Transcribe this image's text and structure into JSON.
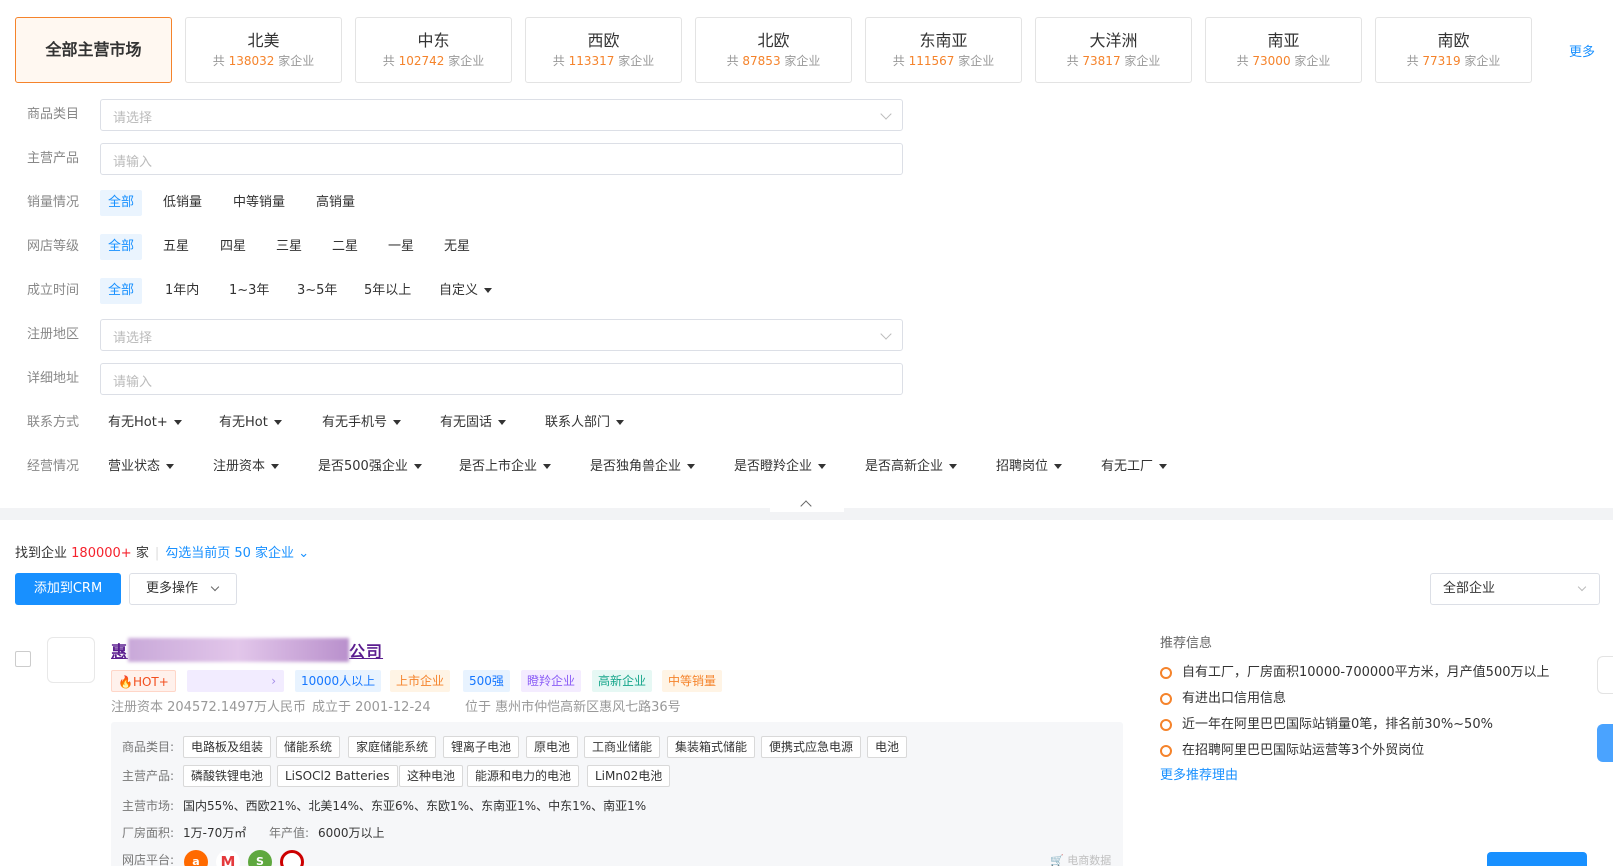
{
  "markets": [
    {
      "name": "全部主营市场",
      "active": true
    },
    {
      "name": "北美",
      "prefix": "共",
      "count": "138032",
      "suffix": "家企业"
    },
    {
      "name": "中东",
      "prefix": "共",
      "count": "102742",
      "suffix": "家企业"
    },
    {
      "name": "西欧",
      "prefix": "共",
      "count": "113317",
      "suffix": "家企业"
    },
    {
      "name": "北欧",
      "prefix": "共",
      "count": "87853",
      "suffix": "家企业"
    },
    {
      "name": "东南亚",
      "prefix": "共",
      "count": "111567",
      "suffix": "家企业"
    },
    {
      "name": "大洋洲",
      "prefix": "共",
      "count": "73817",
      "suffix": "家企业"
    },
    {
      "name": "南亚",
      "prefix": "共",
      "count": "73000",
      "suffix": "家企业"
    },
    {
      "name": "南欧",
      "prefix": "共",
      "count": "77319",
      "suffix": "家企业"
    }
  ],
  "more_label": "更多",
  "filters": {
    "category": {
      "label": "商品类目",
      "placeholder": "请选择"
    },
    "product": {
      "label": "主营产品",
      "placeholder": "请输入"
    },
    "sales": {
      "label": "销量情况",
      "options": [
        "全部",
        "低销量",
        "中等销量",
        "高销量"
      ]
    },
    "shop_level": {
      "label": "网店等级",
      "options": [
        "全部",
        "五星",
        "四星",
        "三星",
        "二星",
        "一星",
        "无星"
      ]
    },
    "founded": {
      "label": "成立时间",
      "options": [
        "全部",
        "1年内",
        "1~3年",
        "3~5年",
        "5年以上"
      ],
      "custom": "自定义"
    },
    "region": {
      "label": "注册地区",
      "placeholder": "请选择"
    },
    "address": {
      "label": "详细地址",
      "placeholder": "请输入"
    },
    "contact": {
      "label": "联系方式",
      "options": [
        "有无Hot+",
        "有无Hot",
        "有无手机号",
        "有无固话",
        "联系人部门"
      ]
    },
    "business": {
      "label": "经营情况",
      "options": [
        "营业状态",
        "注册资本",
        "是否500强企业",
        "是否上市企业",
        "是否独角兽企业",
        "是否瞪羚企业",
        "是否高新企业",
        "招聘岗位",
        "有无工厂"
      ]
    }
  },
  "results": {
    "found_prefix": "找到企业",
    "found_count": "180000+",
    "found_suffix": "家",
    "select_page": "勾选当前页 50 家企业",
    "add_crm": "添加到CRM",
    "more_actions": "更多操作",
    "scope": "全部企业"
  },
  "company": {
    "name_start": "惠",
    "name_end": "公司",
    "tags": {
      "hot": "HOT+",
      "purple": "",
      "staff": "10000人以上",
      "listed": "上市企业",
      "top500": "500强",
      "gazelle": "瞪羚企业",
      "hitech": "高新企业",
      "sales": "中等销量"
    },
    "capital": "注册资本 204572.1497万人民币",
    "founded": "成立于 2001-12-24",
    "location": "位于 惠州市仲恺高新区惠风七路36号",
    "category_label": "商品类目:",
    "categories": [
      "电路板及组装",
      "储能系统",
      "家庭储能系统",
      "锂离子电池",
      "原电池",
      "工商业储能",
      "集装箱式储能",
      "便携式应急电源",
      "电池"
    ],
    "product_label": "主营产品:",
    "products": [
      "磷酸铁锂电池",
      "LiSOCl2 Batteries",
      "这种电池",
      "能源和电力的电池",
      "LiMn02电池"
    ],
    "market_label": "主营市场:",
    "markets": "国内55%、西欧21%、北美14%、东亚6%、东欧1%、东南亚1%、中东1%、南亚1%",
    "factory_label": "厂房面积:",
    "factory": "1万-70万㎡",
    "output_label": "年产值:",
    "output": "6000万以上",
    "platform_label": "网店平台:",
    "ec_data": "电商数据"
  },
  "recommend": {
    "title": "推荐信息",
    "items": [
      "自有工厂，厂房面积10000-700000平方米，月产值500万以上",
      "有进出口信用信息",
      "近一年在阿里巴巴国际站销量0笔，排名前30%~50%",
      "在招聘阿里巴巴国际站运营等3个外贸岗位"
    ],
    "more": "更多推荐理由"
  }
}
